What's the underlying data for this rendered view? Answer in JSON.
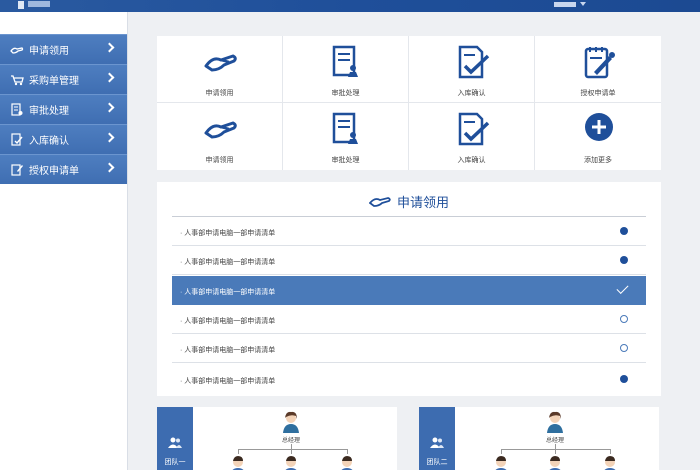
{
  "sidebar": {
    "items": [
      {
        "label": "申请领用",
        "icon": "handshake-icon"
      },
      {
        "label": "采购单管理",
        "icon": "cart-icon"
      },
      {
        "label": "审批处理",
        "icon": "approve-icon"
      },
      {
        "label": "入库确认",
        "icon": "checklist-icon"
      },
      {
        "label": "授权申请单",
        "icon": "edit-icon"
      }
    ]
  },
  "tiles": [
    {
      "label": "申请领用",
      "icon": "handshake-icon"
    },
    {
      "label": "审批处理",
      "icon": "approve-icon"
    },
    {
      "label": "入库确认",
      "icon": "checklist-icon"
    },
    {
      "label": "授权申请单",
      "icon": "authorize-icon"
    },
    {
      "label": "申请领用",
      "icon": "handshake-icon"
    },
    {
      "label": "审批处理",
      "icon": "approve-icon"
    },
    {
      "label": "入库确认",
      "icon": "checklist-icon"
    },
    {
      "label": "添加更多",
      "icon": "plus-circle-icon"
    }
  ],
  "apply": {
    "title": "申请领用",
    "rows": [
      {
        "text": "· 人事部申请电脑一部申请清单",
        "state": "filled"
      },
      {
        "text": "· 人事部申请电脑一部申请清单",
        "state": "filled"
      },
      {
        "text": "· 人事部申请电脑一部申请清单",
        "state": "checked"
      },
      {
        "text": "· 人事部申请电脑一部申请清单",
        "state": "open"
      },
      {
        "text": "· 人事部申请电脑一部申请清单",
        "state": "open"
      },
      {
        "text": "· 人事部申请电脑一部申请清单",
        "state": "filled"
      }
    ]
  },
  "teams": [
    {
      "label": "团队一",
      "manager": "总经理"
    },
    {
      "label": "团队二",
      "manager": "总经理"
    }
  ],
  "colors": {
    "primary": "#1f4f9a",
    "menu": "#4a7ab9",
    "background": "#eef0f3"
  }
}
